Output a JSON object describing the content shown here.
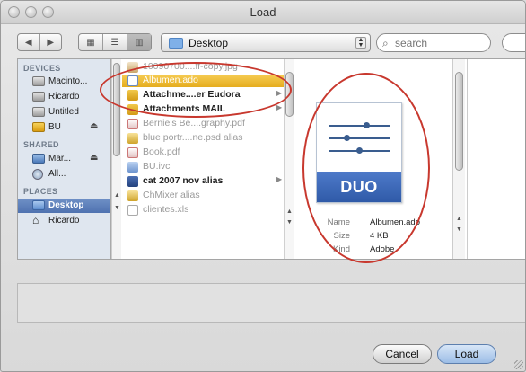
{
  "window": {
    "title": "Load"
  },
  "toolbar": {
    "back_icon": "back-arrow-icon",
    "forward_icon": "forward-arrow-icon",
    "location": "Desktop",
    "search_placeholder": "search"
  },
  "sidebar": {
    "devices_header": "DEVICES",
    "devices": [
      {
        "label": "Macinto...",
        "icon": "hard-drive-icon",
        "eject": false
      },
      {
        "label": "Ricardo",
        "icon": "hard-drive-icon",
        "eject": false
      },
      {
        "label": "Untitled",
        "icon": "hard-drive-icon",
        "eject": false
      },
      {
        "label": "BU",
        "icon": "drive-icon",
        "eject": true
      }
    ],
    "shared_header": "SHARED",
    "shared": [
      {
        "label": "Mar...",
        "icon": "network-computer-icon",
        "eject": true
      },
      {
        "label": "All...",
        "icon": "network-globe-icon",
        "eject": false
      }
    ],
    "places_header": "PLACES",
    "places": [
      {
        "label": "Desktop",
        "icon": "desktop-folder-icon",
        "selected": true
      },
      {
        "label": "Ricardo",
        "icon": "home-icon",
        "selected": false
      }
    ],
    "eject_glyph": "⏏"
  },
  "files": [
    {
      "name": "10090700....ff-copy.jpg",
      "style": "dim"
    },
    {
      "name": "Albumen.ado",
      "style": "selected"
    },
    {
      "name": "Attachme....er Eudora",
      "style": "bold",
      "folder": true
    },
    {
      "name": "Attachments MAIL",
      "style": "bold",
      "folder": true
    },
    {
      "name": "Bernie's Be....graphy.pdf",
      "style": "dim"
    },
    {
      "name": "blue portr....ne.psd alias",
      "style": "dim"
    },
    {
      "name": "Book.pdf",
      "style": "dim"
    },
    {
      "name": "BU.ivc",
      "style": "dim"
    },
    {
      "name": "cat 2007 nov alias",
      "style": "bold",
      "folder": true
    },
    {
      "name": "ChMixer alias",
      "style": "dim"
    },
    {
      "name": "clientes.xls",
      "style": "dim"
    }
  ],
  "preview": {
    "badge": "DUO",
    "name_key": "Name",
    "name_val": "Albumen.ado",
    "size_key": "Size",
    "size_val": "4 KB",
    "kind_key": "Kind",
    "kind_val": "Adobe"
  },
  "buttons": {
    "cancel": "Cancel",
    "load": "Load"
  },
  "colors": {
    "selection": "#e5ad1f",
    "annotation": "#c8382e",
    "sidebar_selection": "#4f72b0"
  }
}
